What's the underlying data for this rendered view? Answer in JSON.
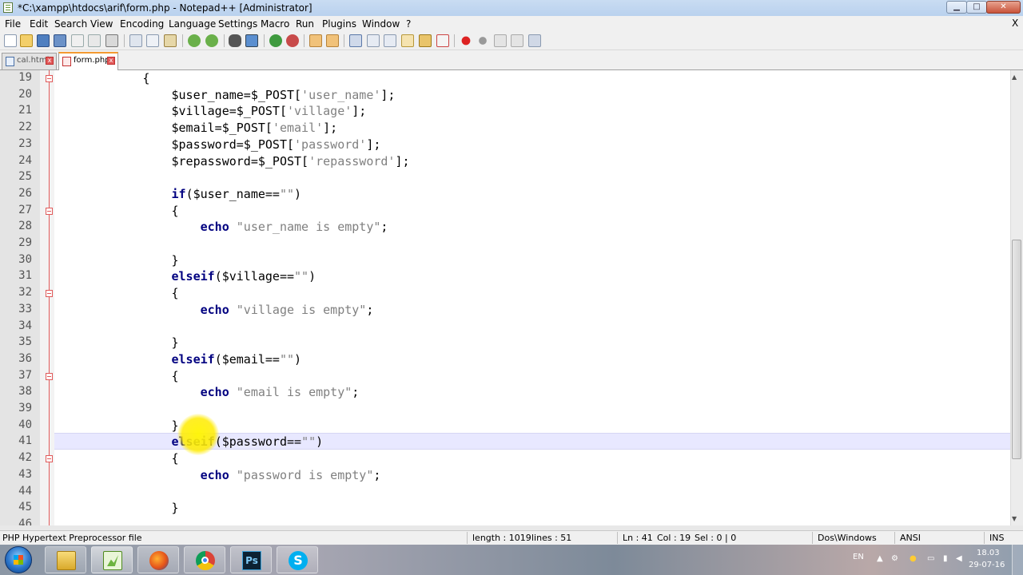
{
  "window": {
    "title": "*C:\\xampp\\htdocs\\arif\\form.php - Notepad++ [Administrator]",
    "controls": {
      "minimize": "▁",
      "maximize": "□",
      "close": "✕"
    }
  },
  "menu": {
    "items": [
      "File",
      "Edit",
      "Search",
      "View",
      "Encoding",
      "Language",
      "Settings",
      "Macro",
      "Run",
      "Plugins",
      "Window",
      "?"
    ],
    "close_doc": "X"
  },
  "toolbar": {
    "icons": [
      "new-file-icon",
      "open-file-icon",
      "save-icon",
      "save-all-icon",
      "close-icon",
      "close-all-icon",
      "print-icon",
      "cut-icon",
      "copy-icon",
      "paste-icon",
      "undo-icon",
      "redo-icon",
      "find-icon",
      "replace-icon",
      "zoom-in-icon",
      "zoom-out-icon",
      "sync-v-icon",
      "sync-h-icon",
      "word-wrap-icon",
      "show-all-chars-icon",
      "indent-guide-icon",
      "udl-icon",
      "doc-map-icon",
      "function-list-icon",
      "record-macro-icon",
      "stop-macro-icon",
      "play-macro-icon",
      "run-macro-multiple-icon",
      "save-macro-icon"
    ]
  },
  "tabs": [
    {
      "label": "cal.html",
      "active": false
    },
    {
      "label": "form.php",
      "active": true
    }
  ],
  "editor": {
    "current_line": 41,
    "lines": [
      {
        "n": "19",
        "fold": true,
        "code": "            {"
      },
      {
        "n": "20",
        "fold": false,
        "code": "                $user_name=$_POST['user_name'];"
      },
      {
        "n": "21",
        "fold": false,
        "code": "                $village=$_POST['village'];"
      },
      {
        "n": "22",
        "fold": false,
        "code": "                $email=$_POST['email'];"
      },
      {
        "n": "23",
        "fold": false,
        "code": "                $password=$_POST['password'];"
      },
      {
        "n": "24",
        "fold": false,
        "code": "                $repassword=$_POST['repassword'];"
      },
      {
        "n": "25",
        "fold": false,
        "code": ""
      },
      {
        "n": "26",
        "fold": false,
        "code": "                if($user_name==\"\")"
      },
      {
        "n": "27",
        "fold": true,
        "code": "                {"
      },
      {
        "n": "28",
        "fold": false,
        "code": "                    echo \"user_name is empty\";"
      },
      {
        "n": "29",
        "fold": false,
        "code": ""
      },
      {
        "n": "30",
        "fold": false,
        "code": "                }"
      },
      {
        "n": "31",
        "fold": false,
        "code": "                elseif($village==\"\")"
      },
      {
        "n": "32",
        "fold": true,
        "code": "                {"
      },
      {
        "n": "33",
        "fold": false,
        "code": "                    echo \"village is empty\";"
      },
      {
        "n": "34",
        "fold": false,
        "code": ""
      },
      {
        "n": "35",
        "fold": false,
        "code": "                }"
      },
      {
        "n": "36",
        "fold": false,
        "code": "                elseif($email==\"\")"
      },
      {
        "n": "37",
        "fold": true,
        "code": "                {"
      },
      {
        "n": "38",
        "fold": false,
        "code": "                    echo \"email is empty\";"
      },
      {
        "n": "39",
        "fold": false,
        "code": ""
      },
      {
        "n": "40",
        "fold": false,
        "code": "                }"
      },
      {
        "n": "41",
        "fold": false,
        "code": "                elseif($password==\"\")"
      },
      {
        "n": "42",
        "fold": true,
        "code": "                {"
      },
      {
        "n": "43",
        "fold": false,
        "code": "                    echo \"password is empty\";"
      },
      {
        "n": "44",
        "fold": false,
        "code": ""
      },
      {
        "n": "45",
        "fold": false,
        "code": "                }"
      },
      {
        "n": "46",
        "fold": false,
        "code": ""
      }
    ]
  },
  "statusbar": {
    "file_type": "PHP Hypertext Preprocessor file",
    "length": "length : 1019",
    "lines": "lines : 51",
    "ln": "Ln : 41",
    "col": "Col : 19",
    "sel": "Sel : 0 | 0",
    "eol": "Dos\\Windows",
    "encoding": "ANSI",
    "mode": "INS"
  },
  "taskbar": {
    "apps": [
      "explorer-icon",
      "notepadpp-icon",
      "firefox-icon",
      "chrome-icon",
      "photoshop-icon",
      "skype-icon"
    ],
    "ps_label": "Ps",
    "skype_label": "S",
    "lang": "EN",
    "time": "18.03",
    "date": "29-07-16"
  },
  "colors": {
    "keyword": "#000080",
    "string": "#808080",
    "current_line": "#e8e8ff",
    "fold_marker": "#e05a5a",
    "highlight": "#fff000"
  }
}
